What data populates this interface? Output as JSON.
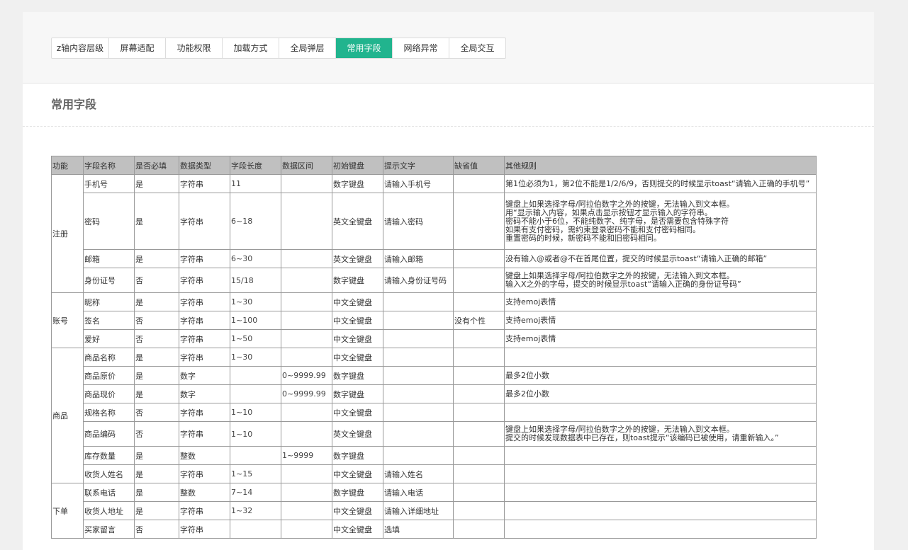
{
  "tabs": [
    {
      "label": "z轴内容层级",
      "active": false
    },
    {
      "label": "屏幕适配",
      "active": false
    },
    {
      "label": "功能权限",
      "active": false
    },
    {
      "label": "加载方式",
      "active": false
    },
    {
      "label": "全局弹层",
      "active": false
    },
    {
      "label": "常用字段",
      "active": true
    },
    {
      "label": "网络异常",
      "active": false
    },
    {
      "label": "全局交互",
      "active": false
    }
  ],
  "section_title": "常用字段",
  "table": {
    "headers": [
      "功能",
      "字段名称",
      "是否必填",
      "数据类型",
      "字段长度",
      "数据区间",
      "初始键盘",
      "提示文字",
      "缺省值",
      "其他规则"
    ],
    "groups": [
      {
        "name": "注册",
        "rows": [
          {
            "field": "手机号",
            "required": "是",
            "type": "字符串",
            "length": "11",
            "range": "",
            "keyboard": "数字键盘",
            "hint": "请输入手机号",
            "default": "",
            "rules": [
              "第1位必须为1，第2位不能是1/2/6/9，否则提交的时候显示toast“请输入正确的手机号”"
            ]
          },
          {
            "field": "密码",
            "required": "是",
            "type": "字符串",
            "length": "6~18",
            "range": "",
            "keyboard": "英文全键盘",
            "hint": "请输入密码",
            "default": "",
            "rules": [
              "键盘上如果选择字母/阿拉伯数字之外的按键，无法输入到文本框。",
              "用“显示输入内容，如果点击显示按钮才显示输入的字符串。",
              "密码不能小于6位，不能纯数字、纯字母，是否需要包含特殊字符",
              "如果有支付密码，需约束登录密码不能和支付密码相同。",
              "重置密码的时候，新密码不能和旧密码相同。"
            ]
          },
          {
            "field": "邮箱",
            "required": "是",
            "type": "字符串",
            "length": "6~30",
            "range": "",
            "keyboard": "英文全键盘",
            "hint": "请输入邮箱",
            "default": "",
            "rules": [
              "没有输入@或者@不在首尾位置，提交的时候显示toast“请输入正确的邮箱”"
            ]
          },
          {
            "field": "身份证号",
            "required": "否",
            "type": "字符串",
            "length": "15/18",
            "range": "",
            "keyboard": "数字键盘",
            "hint": "请输入身份证号码",
            "default": "",
            "rules": [
              "键盘上如果选择字母/阿拉伯数字之外的按键，无法输入到文本框。",
              "输入X之外的字母，提交的时候显示toast“请输入正确的身份证号码”"
            ]
          }
        ]
      },
      {
        "name": "账号",
        "rows": [
          {
            "field": "昵称",
            "required": "是",
            "type": "字符串",
            "length": "1~30",
            "range": "",
            "keyboard": "中文全键盘",
            "hint": "",
            "default": "",
            "rules": [
              "支持emoj表情"
            ]
          },
          {
            "field": "签名",
            "required": "否",
            "type": "字符串",
            "length": "1~100",
            "range": "",
            "keyboard": "中文全键盘",
            "hint": "",
            "default": "没有个性",
            "rules": [
              "支持emoj表情"
            ]
          },
          {
            "field": "爱好",
            "required": "否",
            "type": "字符串",
            "length": "1~50",
            "range": "",
            "keyboard": "中文全键盘",
            "hint": "",
            "default": "",
            "rules": [
              "支持emoj表情"
            ]
          }
        ]
      },
      {
        "name": "商品",
        "rows": [
          {
            "field": "商品名称",
            "required": "是",
            "type": "字符串",
            "length": "1~30",
            "range": "",
            "keyboard": "中文全键盘",
            "hint": "",
            "default": "",
            "rules": [
              ""
            ]
          },
          {
            "field": "商品原价",
            "required": "是",
            "type": "数字",
            "length": "",
            "range": "0~9999.99",
            "keyboard": "数字键盘",
            "hint": "",
            "default": "",
            "rules": [
              "最多2位小数"
            ]
          },
          {
            "field": "商品现价",
            "required": "是",
            "type": "数字",
            "length": "",
            "range": "0~9999.99",
            "keyboard": "数字键盘",
            "hint": "",
            "default": "",
            "rules": [
              "最多2位小数"
            ]
          },
          {
            "field": "规格名称",
            "required": "否",
            "type": "字符串",
            "length": "1~10",
            "range": "",
            "keyboard": "中文全键盘",
            "hint": "",
            "default": "",
            "rules": [
              ""
            ]
          },
          {
            "field": "商品编码",
            "required": "否",
            "type": "字符串",
            "length": "1~10",
            "range": "",
            "keyboard": "英文全键盘",
            "hint": "",
            "default": "",
            "rules": [
              "键盘上如果选择字母/阿拉伯数字之外的按键，无法输入到文本框。",
              "提交的时候发现数据表中已存在，则toast提示“该编码已被使用，请重新输入。”"
            ]
          },
          {
            "field": "库存数量",
            "required": "是",
            "type": "整数",
            "length": "",
            "range": "1~9999",
            "keyboard": "数字键盘",
            "hint": "",
            "default": "",
            "rules": [
              ""
            ]
          },
          {
            "field": "收货人姓名",
            "required": "是",
            "type": "字符串",
            "length": "1~15",
            "range": "",
            "keyboard": "中文全键盘",
            "hint": "请输入姓名",
            "default": "",
            "rules": [
              ""
            ]
          }
        ]
      },
      {
        "name": "下单",
        "rows": [
          {
            "field": "联系电话",
            "required": "是",
            "type": "整数",
            "length": "7~14",
            "range": "",
            "keyboard": "数字键盘",
            "hint": "请输入电话",
            "default": "",
            "rules": [
              ""
            ]
          },
          {
            "field": "收货人地址",
            "required": "是",
            "type": "字符串",
            "length": "1~32",
            "range": "",
            "keyboard": "中文全键盘",
            "hint": "请输入详细地址",
            "default": "",
            "rules": [
              ""
            ]
          },
          {
            "field": "买家留言",
            "required": "否",
            "type": "字符串",
            "length": "",
            "range": "",
            "keyboard": "中文全键盘",
            "hint": "选填",
            "default": "",
            "rules": [
              ""
            ]
          }
        ]
      }
    ]
  }
}
